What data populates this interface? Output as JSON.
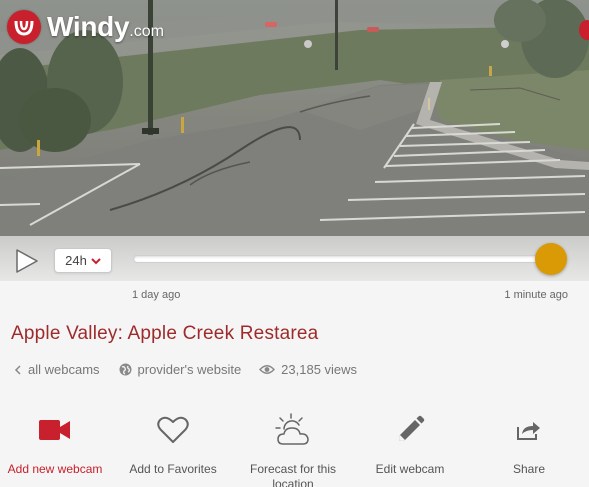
{
  "brand": {
    "name": "Windy",
    "domain": ".com",
    "color": "#c8202c"
  },
  "player": {
    "range_value": "24h",
    "start_label": "1 day ago",
    "end_label": "1 minute ago",
    "position": 1.0,
    "accent": "#d99a06"
  },
  "webcam": {
    "title": "Apple Valley: Apple Creek Restarea",
    "all_webcams": "all webcams",
    "provider": "provider's website",
    "views": "23,185 views"
  },
  "actions": [
    {
      "label": "Add new webcam",
      "icon": "video-camera-icon"
    },
    {
      "label": "Add to Favorites",
      "icon": "heart-icon"
    },
    {
      "label": "Forecast for this location",
      "icon": "weather-icon"
    },
    {
      "label": "Edit webcam",
      "icon": "pencil-icon"
    },
    {
      "label": "Share",
      "icon": "share-icon"
    }
  ]
}
